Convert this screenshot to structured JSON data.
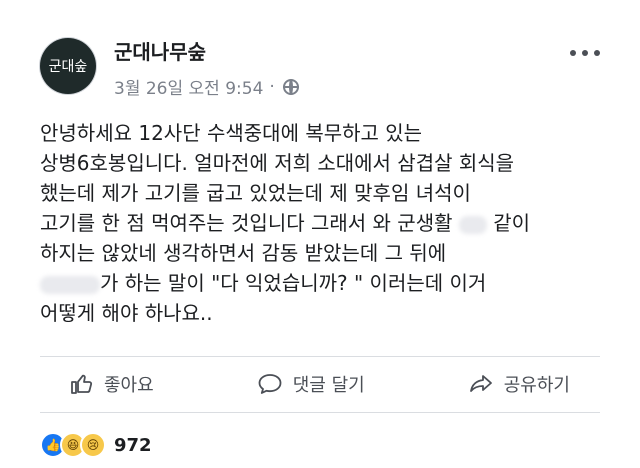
{
  "post": {
    "page_name": "군대나무숲",
    "avatar_text": "군대숲",
    "timestamp": "3월 26일 오전 9:54",
    "separator": "·",
    "body_lines": [
      "안녕하세요 12사단 수색중대에 복무하고 있는",
      "상병6호봉입니다. 얼마전에 저희 소대에서 삼겹살 회식을",
      "했는데 제가 고기를 굽고 있었는데 제 맞후임 녀석이",
      "고기를 한 점 먹여주는 것입니다 그래서 와 군생활 ",
      " 같이",
      "하지는 않았네 생각하면서 감동 받았는데 그 뒤에",
      "가 하는 말이 \"다 익었습니까? \" 이러는데 이거",
      "어떻게 해야 하나요.."
    ]
  },
  "actions": {
    "like": "좋아요",
    "comment": "댓글 달기",
    "share": "공유하기"
  },
  "reactions": {
    "count": "972",
    "icons": [
      "like-icon",
      "haha-icon",
      "sad-icon"
    ]
  }
}
